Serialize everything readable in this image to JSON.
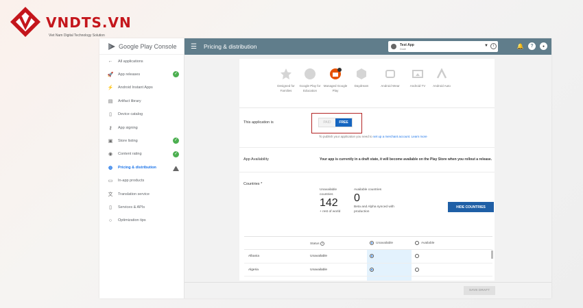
{
  "brand": {
    "name": "VNDTS.VN",
    "tagline": "Viet Nam Digital Technology Solution"
  },
  "sidebar": {
    "title": "Google Play Console",
    "items": [
      {
        "label": "All applications",
        "icon": "arrow-left-icon"
      },
      {
        "label": "App releases",
        "icon": "rocket-icon",
        "status": "check"
      },
      {
        "label": "Android Instant Apps",
        "icon": "bolt-icon"
      },
      {
        "label": "Artifact library",
        "icon": "library-icon"
      },
      {
        "label": "Device catalog",
        "icon": "device-icon"
      },
      {
        "label": "App signing",
        "icon": "key-icon"
      },
      {
        "label": "Store listing",
        "icon": "store-icon",
        "status": "check"
      },
      {
        "label": "Content rating",
        "icon": "rating-icon",
        "status": "check"
      },
      {
        "label": "Pricing & distribution",
        "icon": "globe-icon",
        "status": "warning",
        "active": true
      },
      {
        "label": "In-app products",
        "icon": "card-icon"
      },
      {
        "label": "Translation service",
        "icon": "translate-icon"
      },
      {
        "label": "Services & APIs",
        "icon": "phone-icon"
      },
      {
        "label": "Optimization tips",
        "icon": "bulb-icon"
      }
    ]
  },
  "topbar": {
    "title": "Pricing & distribution",
    "app_name": "Test App",
    "app_status": "Draft"
  },
  "distribution": [
    {
      "label": "Designed for Families",
      "icon": "star-badge-icon"
    },
    {
      "label": "Google Play for Education",
      "icon": "education-icon"
    },
    {
      "label": "Managed Google Play",
      "icon": "briefcase-icon"
    },
    {
      "label": "Daydream",
      "icon": "daydream-icon"
    },
    {
      "label": "Android Wear",
      "icon": "watch-icon"
    },
    {
      "label": "Android TV",
      "icon": "tv-icon"
    },
    {
      "label": "Android Auto",
      "icon": "auto-icon"
    }
  ],
  "pricing": {
    "label": "This application is",
    "paid": "PAID",
    "free": "FREE",
    "note_prefix": "To publish your application you need to",
    "note_link1": "set up a merchant account",
    "note_link2": "Learn more"
  },
  "availability": {
    "label": "App Availability",
    "text": "Your app is currently in a draft state, it will become available on the Play Store when you rollout a release."
  },
  "countries": {
    "label": "Countries *",
    "unavailable_label": "Unavailable countries",
    "unavailable_count": "142",
    "unavailable_sub": "+ rest of world",
    "available_label": "Available countries",
    "available_count": "0",
    "available_sub": "Beta and Alpha synced with production",
    "hide_button": "HIDE COUNTRIES",
    "table": {
      "status_header": "Status",
      "unavailable_header": "Unavailable",
      "available_header": "Available",
      "rows": [
        {
          "country": "Albania",
          "status": "Unavailable"
        },
        {
          "country": "Algeria",
          "status": "Unavailable"
        },
        {
          "country": "Angola",
          "status": "Unavailable"
        }
      ]
    }
  },
  "footer": {
    "save_draft": "SAVE DRAFT"
  },
  "colors": {
    "brand_red": "#c4161c",
    "topbar": "#607d8b",
    "primary_blue": "#1565c0",
    "check_green": "#4caf50",
    "highlight_border": "#b22222"
  }
}
